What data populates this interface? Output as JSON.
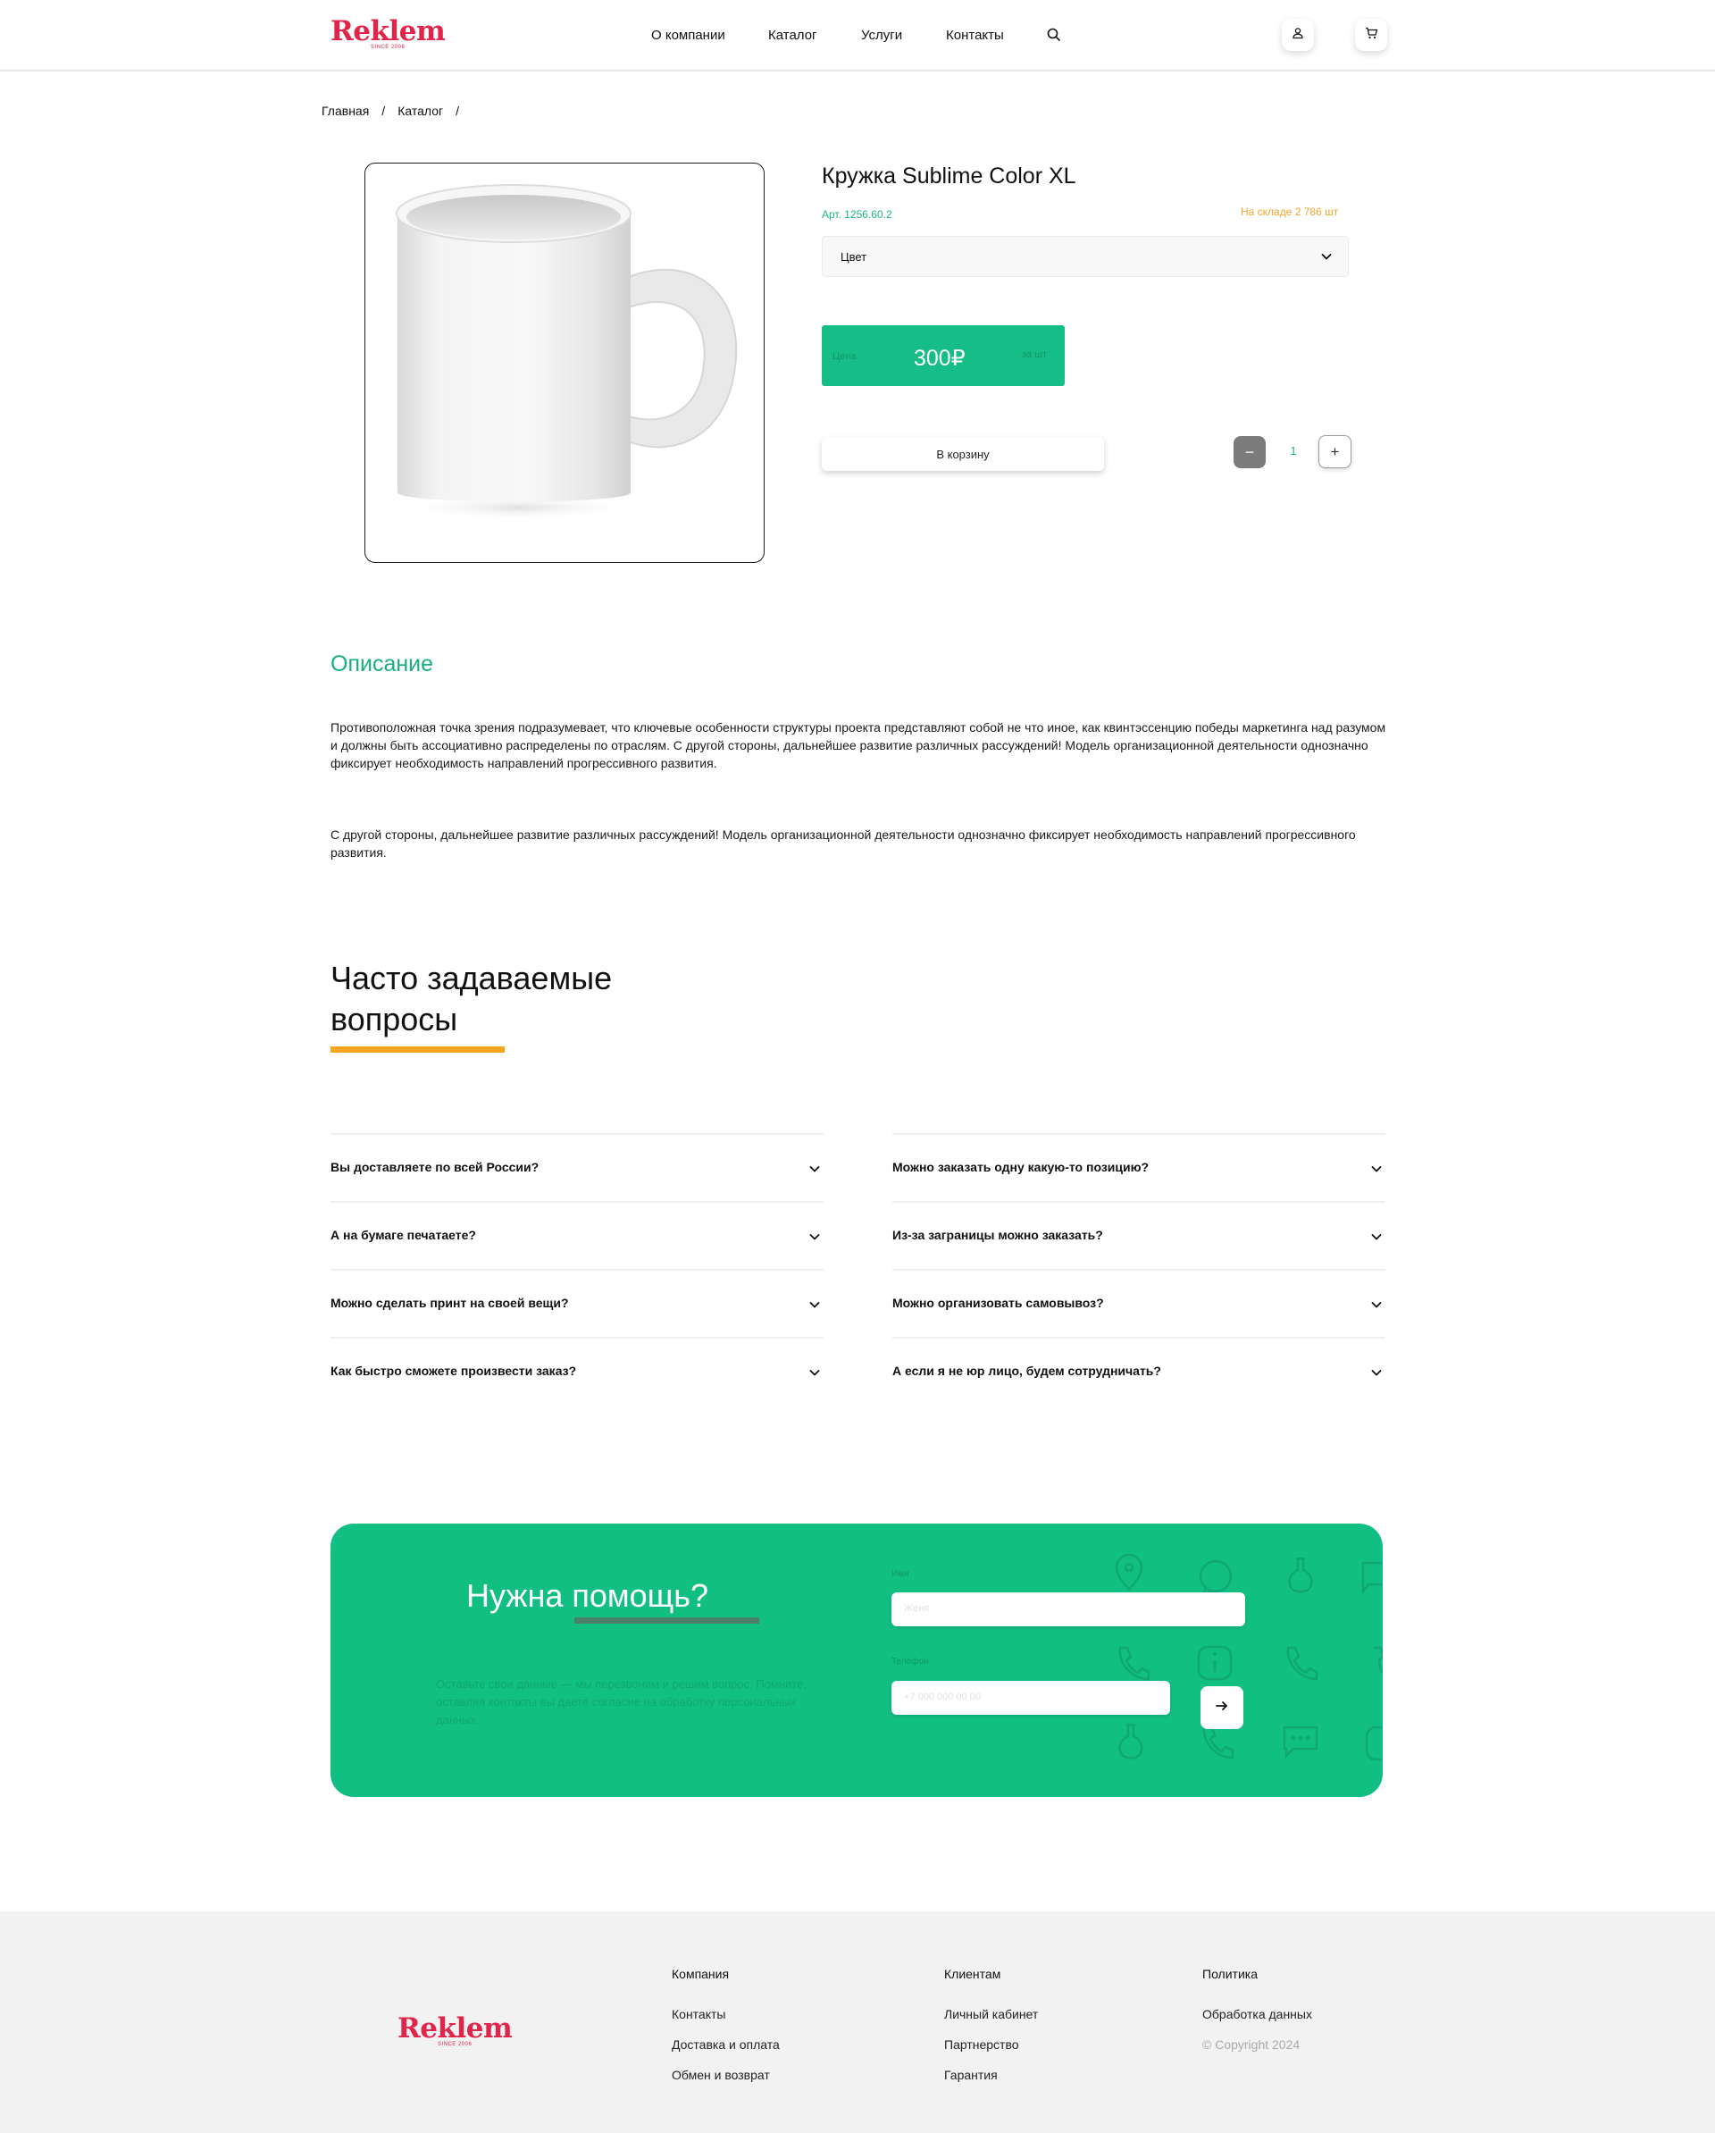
{
  "header": {
    "logo": "Reklem",
    "logo_since": "SINCE 2006",
    "nav": [
      "О компании",
      "Каталог",
      "Услуги",
      "Контакты"
    ]
  },
  "breadcrumb": [
    "Главная",
    "/",
    "Каталог",
    "/"
  ],
  "product": {
    "title": "Кружка Sublime Color XL",
    "article": "Арт. 1256.60.2",
    "stock": "На складе 2 786 шт",
    "color_label": "Цвет",
    "price_label": "Цена",
    "price": "300₽",
    "price_unit": "за шт",
    "add_to_cart": "В корзину",
    "quantity": "1",
    "minus": "−",
    "plus": "+"
  },
  "description": {
    "title": "Описание",
    "p1": "Противоположная точка зрения подразумевает, что ключевые особенности структуры проекта представляют собой не что иное, как квинтэссенцию победы маркетинга над разумом и должны быть ассоциативно распределены по отраслям. С другой стороны, дальнейшее развитие различных рассуждений! Модель организационной деятельности однозначно фиксирует необходимость направлений прогрессивного развития.",
    "p2": "С другой стороны, дальнейшее развитие различных рассуждений! Модель организационной деятельности однозначно фиксирует необходимость направлений прогрессивного развития."
  },
  "faq": {
    "title": "Часто задаваемые вопросы",
    "left": [
      "Вы доставляете по всей России?",
      "А на бумаге печатаете?",
      "Можно сделать принт на своей вещи?",
      "Как быстро сможете произвести заказ?"
    ],
    "right": [
      "Можно заказать одну какую-то позицию?",
      "Из-за заграницы можно заказать?",
      "Можно организовать самовывоз?",
      "А если я не юр лицо, будем сотрудничать?"
    ]
  },
  "help": {
    "title": "Нужна помощь?",
    "text": "Оставьте свои данные — мы перезвоним и решим вопрос. Помните, оставляя контакты вы даете согласие на обработку персональных данных.",
    "name_label": "Имя",
    "name_placeholder": "Женя",
    "phone_label": "Телефон",
    "phone_placeholder": "+7 000 000 00 00"
  },
  "footer": {
    "logo": "Reklem",
    "logo_since": "SINCE 2006",
    "columns": [
      {
        "head": "Компания",
        "links": [
          "Контакты",
          "Доставка и оплата",
          "Обмен и возврат"
        ]
      },
      {
        "head": "Клиентам",
        "links": [
          "Личный кабинет",
          "Партнерство",
          "Гарантия"
        ]
      },
      {
        "head": "Политика",
        "links": [
          "Обработка данных"
        ],
        "copyright": "© Copyright 2024"
      }
    ]
  },
  "colors": {
    "brand_red": "#e0244a",
    "accent_green": "#12bf82",
    "accent_orange": "#f7a51f"
  }
}
